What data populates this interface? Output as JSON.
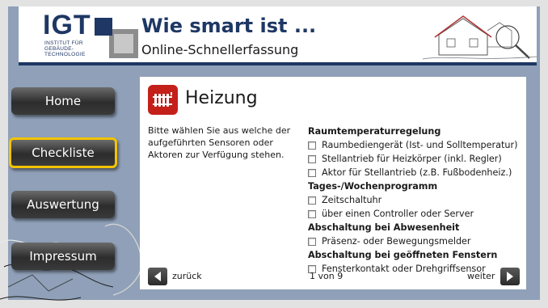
{
  "header": {
    "logo_text": "IGT",
    "logo_subtext": [
      "INSTITUT FÜR",
      "GEBÄUDE-",
      "TECHNOLOGIE"
    ],
    "title": "Wie smart ist ...",
    "subtitle": "Online-Schnellerfassung"
  },
  "nav": {
    "items": [
      {
        "label": "Home",
        "active": false
      },
      {
        "label": "Checkliste",
        "active": true
      },
      {
        "label": "Auswertung",
        "active": false
      },
      {
        "label": "Impressum",
        "active": false
      }
    ]
  },
  "panel": {
    "icon": "radiator-icon",
    "title": "Heizung",
    "intro": "Bitte wählen Sie aus welche der aufgeführten Sensoren oder Aktoren zur Verfügung stehen.",
    "groups": [
      {
        "heading": "Raumtemperaturregelung",
        "options": [
          {
            "label": "Raumbediengerät (Ist- und Solltemperatur)",
            "checked": false
          },
          {
            "label": "Stellantrieb für Heizkörper (inkl. Regler)",
            "checked": false
          },
          {
            "label": "Aktor für Stellantrieb (z.B. Fußbodenheiz.)",
            "checked": false
          }
        ]
      },
      {
        "heading": "Tages-/Wochenprogramm",
        "options": [
          {
            "label": "Zeitschaltuhr",
            "checked": false
          },
          {
            "label": "über einen Controller oder Server",
            "checked": false
          }
        ]
      },
      {
        "heading": "Abschaltung bei Abwesenheit",
        "options": [
          {
            "label": "Präsenz- oder Bewegungsmelder",
            "checked": false
          }
        ]
      },
      {
        "heading": "Abschaltung bei geöffneten Fenstern",
        "options": [
          {
            "label": "Fensterkontakt oder Drehgriffsensor",
            "checked": false
          }
        ]
      }
    ],
    "back_label": "zurück",
    "page_indicator": "1 von 9",
    "next_label": "weiter"
  },
  "colors": {
    "background": "#8fa0b8",
    "brand_navy": "#1e3764",
    "active_border": "#f2c300",
    "icon_red": "#c4201a"
  }
}
